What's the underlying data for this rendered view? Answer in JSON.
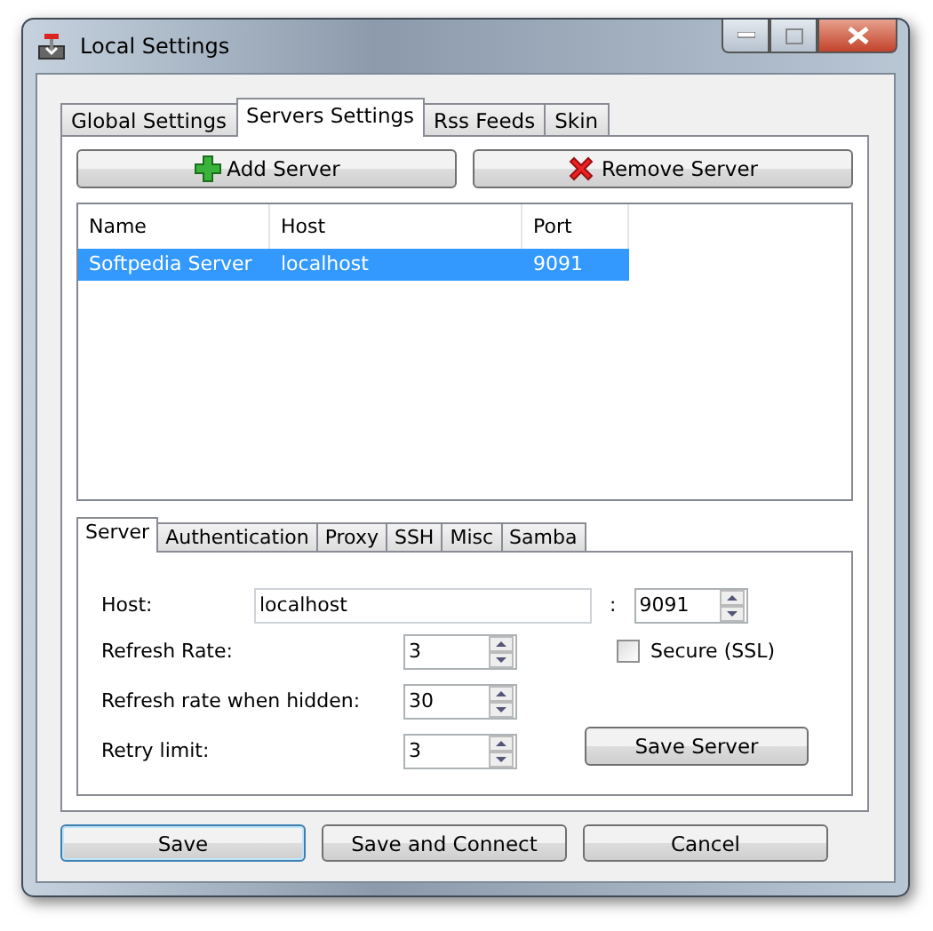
{
  "window": {
    "title": "Local Settings"
  },
  "tabs": [
    {
      "label": "Global Settings",
      "selected": false
    },
    {
      "label": "Servers Settings",
      "selected": true
    },
    {
      "label": "Rss Feeds",
      "selected": false
    },
    {
      "label": "Skin",
      "selected": false
    }
  ],
  "server_buttons": [
    {
      "label": "Add Server",
      "kind": "add"
    },
    {
      "label": "Remove Server",
      "kind": "remove"
    }
  ],
  "table": {
    "columns": [
      "Name",
      "Host",
      "Port"
    ],
    "rows": [
      {
        "cells": [
          "Softpedia Server",
          "localhost",
          "9091"
        ],
        "selected": true
      }
    ]
  },
  "detail_tabs": [
    {
      "label": "Server",
      "selected": true
    },
    {
      "label": "Authentication",
      "selected": false
    },
    {
      "label": "Proxy",
      "selected": false
    },
    {
      "label": "SSH",
      "selected": false
    },
    {
      "label": "Misc",
      "selected": false
    },
    {
      "label": "Samba",
      "selected": false
    }
  ],
  "host": {
    "label": "Host:",
    "value": "localhost",
    "separator": ":",
    "port": "9091"
  },
  "spinners": [
    {
      "label": "Refresh Rate:",
      "value": "3"
    },
    {
      "label": "Refresh rate when hidden:",
      "value": "30"
    },
    {
      "label": "Retry limit:",
      "value": "3"
    }
  ],
  "secure": {
    "label": "Secure (SSL)",
    "checked": false
  },
  "save_server": "Save Server",
  "footer_buttons": [
    {
      "label": "Save",
      "default": true
    },
    {
      "label": "Save and Connect",
      "default": false
    },
    {
      "label": "Cancel",
      "default": false
    }
  ]
}
